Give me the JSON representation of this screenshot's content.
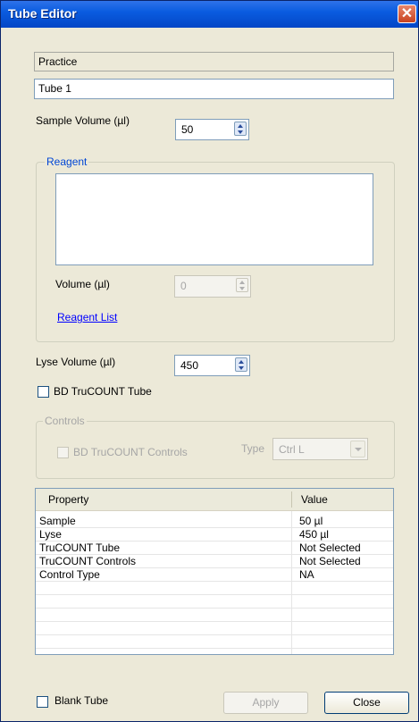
{
  "window": {
    "title": "Tube Editor",
    "close_glyph": "✕"
  },
  "experiment_field": {
    "value": "Practice"
  },
  "tube_name_field": {
    "value": "Tube 1"
  },
  "sample_volume": {
    "label": "Sample Volume (µl)",
    "value": "50"
  },
  "reagent": {
    "group_label": "Reagent",
    "volume_label": "Volume (µl)",
    "volume_value": "0",
    "list_link": "Reagent List"
  },
  "lyse_volume": {
    "label": "Lyse Volume (µl)",
    "value": "450"
  },
  "trucount_tube": {
    "label": "BD TruCOUNT Tube"
  },
  "controls": {
    "group_label": "Controls",
    "checkbox_label": "BD TruCOUNT Controls",
    "type_label": "Type",
    "type_value": "Ctrl L"
  },
  "properties_table": {
    "headers": [
      "Property",
      "Value"
    ],
    "rows": [
      [
        "Sample",
        "50 µl"
      ],
      [
        "Lyse",
        "450 µl"
      ],
      [
        "TruCOUNT Tube",
        "Not Selected"
      ],
      [
        "TruCOUNT Controls",
        "Not Selected"
      ],
      [
        "Control Type",
        "NA"
      ]
    ]
  },
  "footer": {
    "blank_tube_label": "Blank Tube",
    "apply_label": "Apply",
    "close_label": "Close"
  }
}
